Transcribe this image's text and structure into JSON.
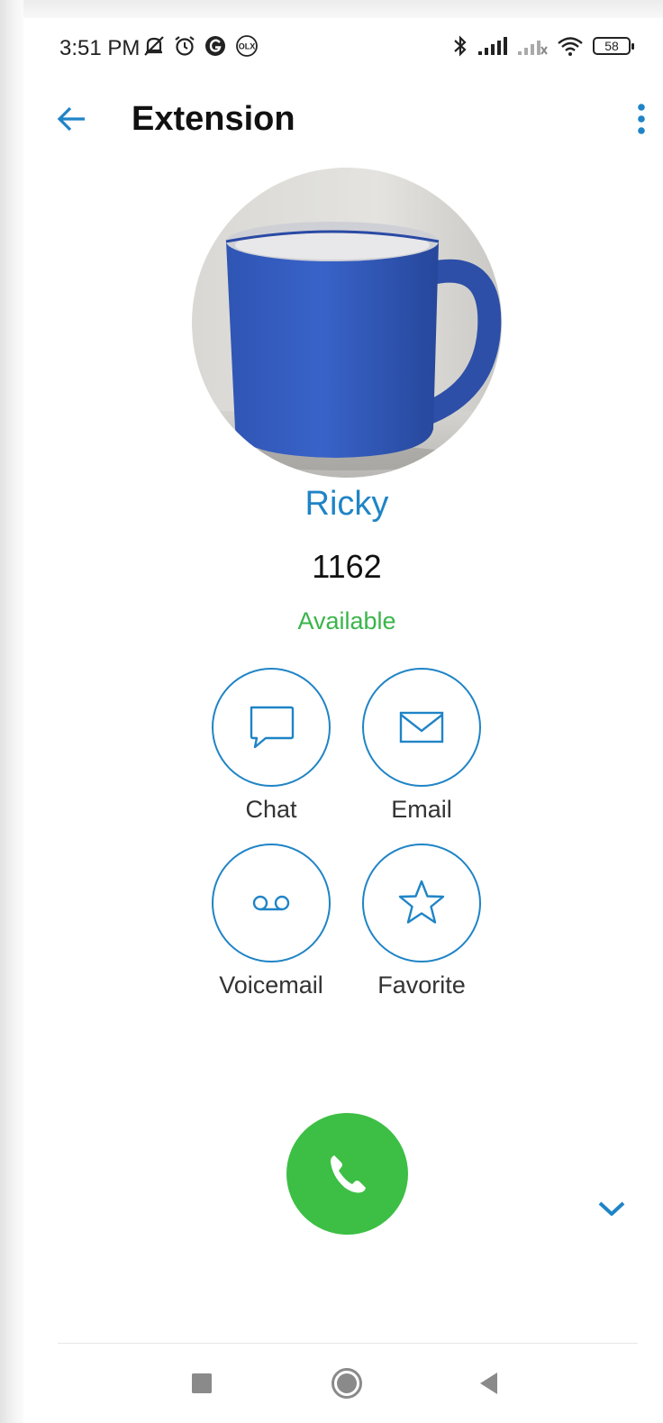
{
  "status_bar": {
    "time": "3:51 PM",
    "battery": "58",
    "left_icons": [
      "muted-bell-icon",
      "alarm-icon",
      "g-app-icon",
      "olx-app-icon"
    ],
    "right_icons": [
      "bluetooth-icon",
      "signal-icon",
      "signal-weak-icon",
      "wifi-icon",
      "battery-icon"
    ]
  },
  "app_bar": {
    "title": "Extension",
    "back_icon": "arrow-left-icon",
    "menu_icon": "more-vert-icon"
  },
  "contact": {
    "name": "Ricky",
    "extension": "1162",
    "status": "Available",
    "avatar": "blue-mug-photo"
  },
  "actions": {
    "chat": "Chat",
    "email": "Email",
    "voicemail": "Voicemail",
    "favorite": "Favorite"
  },
  "call": {
    "icon": "phone-icon",
    "expand_icon": "chevron-down-icon"
  },
  "colors": {
    "accent": "#1f84c6",
    "status_available": "#3ab54a",
    "call_button": "#3cbf44"
  }
}
